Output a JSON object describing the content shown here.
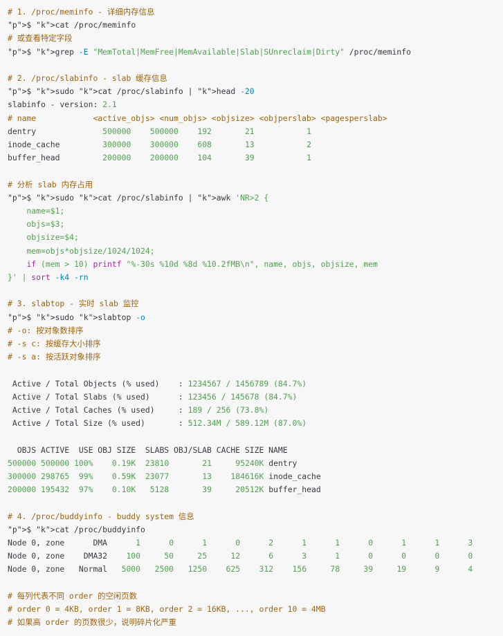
{
  "lines": [
    "# 1. /proc/meminfo - 详细内存信息",
    "$ cat /proc/meminfo",
    "# 或查看特定字段",
    "$ grep -E \"MemTotal|MemFree|MemAvailable|Slab|SUnreclaim|Dirty\" /proc/meminfo",
    "",
    "# 2. /proc/slabinfo - slab 缓存信息",
    "$ sudo cat /proc/slabinfo | head -20",
    "slabinfo - version: 2.1",
    "# name            <active_objs> <num_objs> <objsize> <objperslab> <pagesperslab>",
    "dentry              500000    500000    192       21           1",
    "inode_cache         300000    300000    608       13           2",
    "buffer_head         200000    200000    104       39           1",
    "",
    "# 分析 slab 内存占用",
    "$ sudo cat /proc/slabinfo | awk 'NR>2 {",
    "    name=$1;",
    "    objs=$3;",
    "    objsize=$4;",
    "    mem=objs*objsize/1024/1024;",
    "    if (mem > 10) printf \"%-30s %10d %8d %10.2fMB\\n\", name, objs, objsize, mem",
    "}' | sort -k4 -rn",
    "",
    "# 3. slabtop - 实时 slab 监控",
    "$ sudo slabtop -o",
    "# -o: 按对象数排序",
    "# -s c: 按缓存大小排序",
    "# -s a: 按活跃对象排序",
    "",
    " Active / Total Objects (% used)    : 1234567 / 1456789 (84.7%)",
    " Active / Total Slabs (% used)      : 123456 / 145678 (84.7%)",
    " Active / Total Caches (% used)     : 189 / 256 (73.8%)",
    " Active / Total Size (% used)       : 512.34M / 589.12M (87.0%)",
    "",
    "  OBJS ACTIVE  USE OBJ SIZE  SLABS OBJ/SLAB CACHE SIZE NAME",
    "500000 500000 100%    0.19K  23810       21     95240K dentry",
    "300000 298765  99%    0.59K  23077       13    184616K inode_cache",
    "200000 195432  97%    0.10K   5128       39     20512K buffer_head",
    "",
    "# 4. /proc/buddyinfo - buddy system 信息",
    "$ cat /proc/buddyinfo",
    "Node 0, zone      DMA      1      0      1      0      2      1      1      0      1      1      3",
    "Node 0, zone    DMA32    100     50     25     12      6      3      1      0      0      0      0",
    "Node 0, zone   Normal   5000   2500   1250    625    312    156     78     39     19      9      4",
    "",
    "# 每列代表不同 order 的空闲页数",
    "# order 0 = 4KB, order 1 = 8KB, order 2 = 16KB, ..., order 10 = 4MB",
    "# 如果高 order 的页数很少，说明碎片化严重"
  ],
  "colors": {
    "background": "#f7f7f8",
    "comment": "#a0640c",
    "text": "#383a42",
    "keyword": "#a626a4",
    "string": "#50a14f",
    "number": "#986801"
  }
}
